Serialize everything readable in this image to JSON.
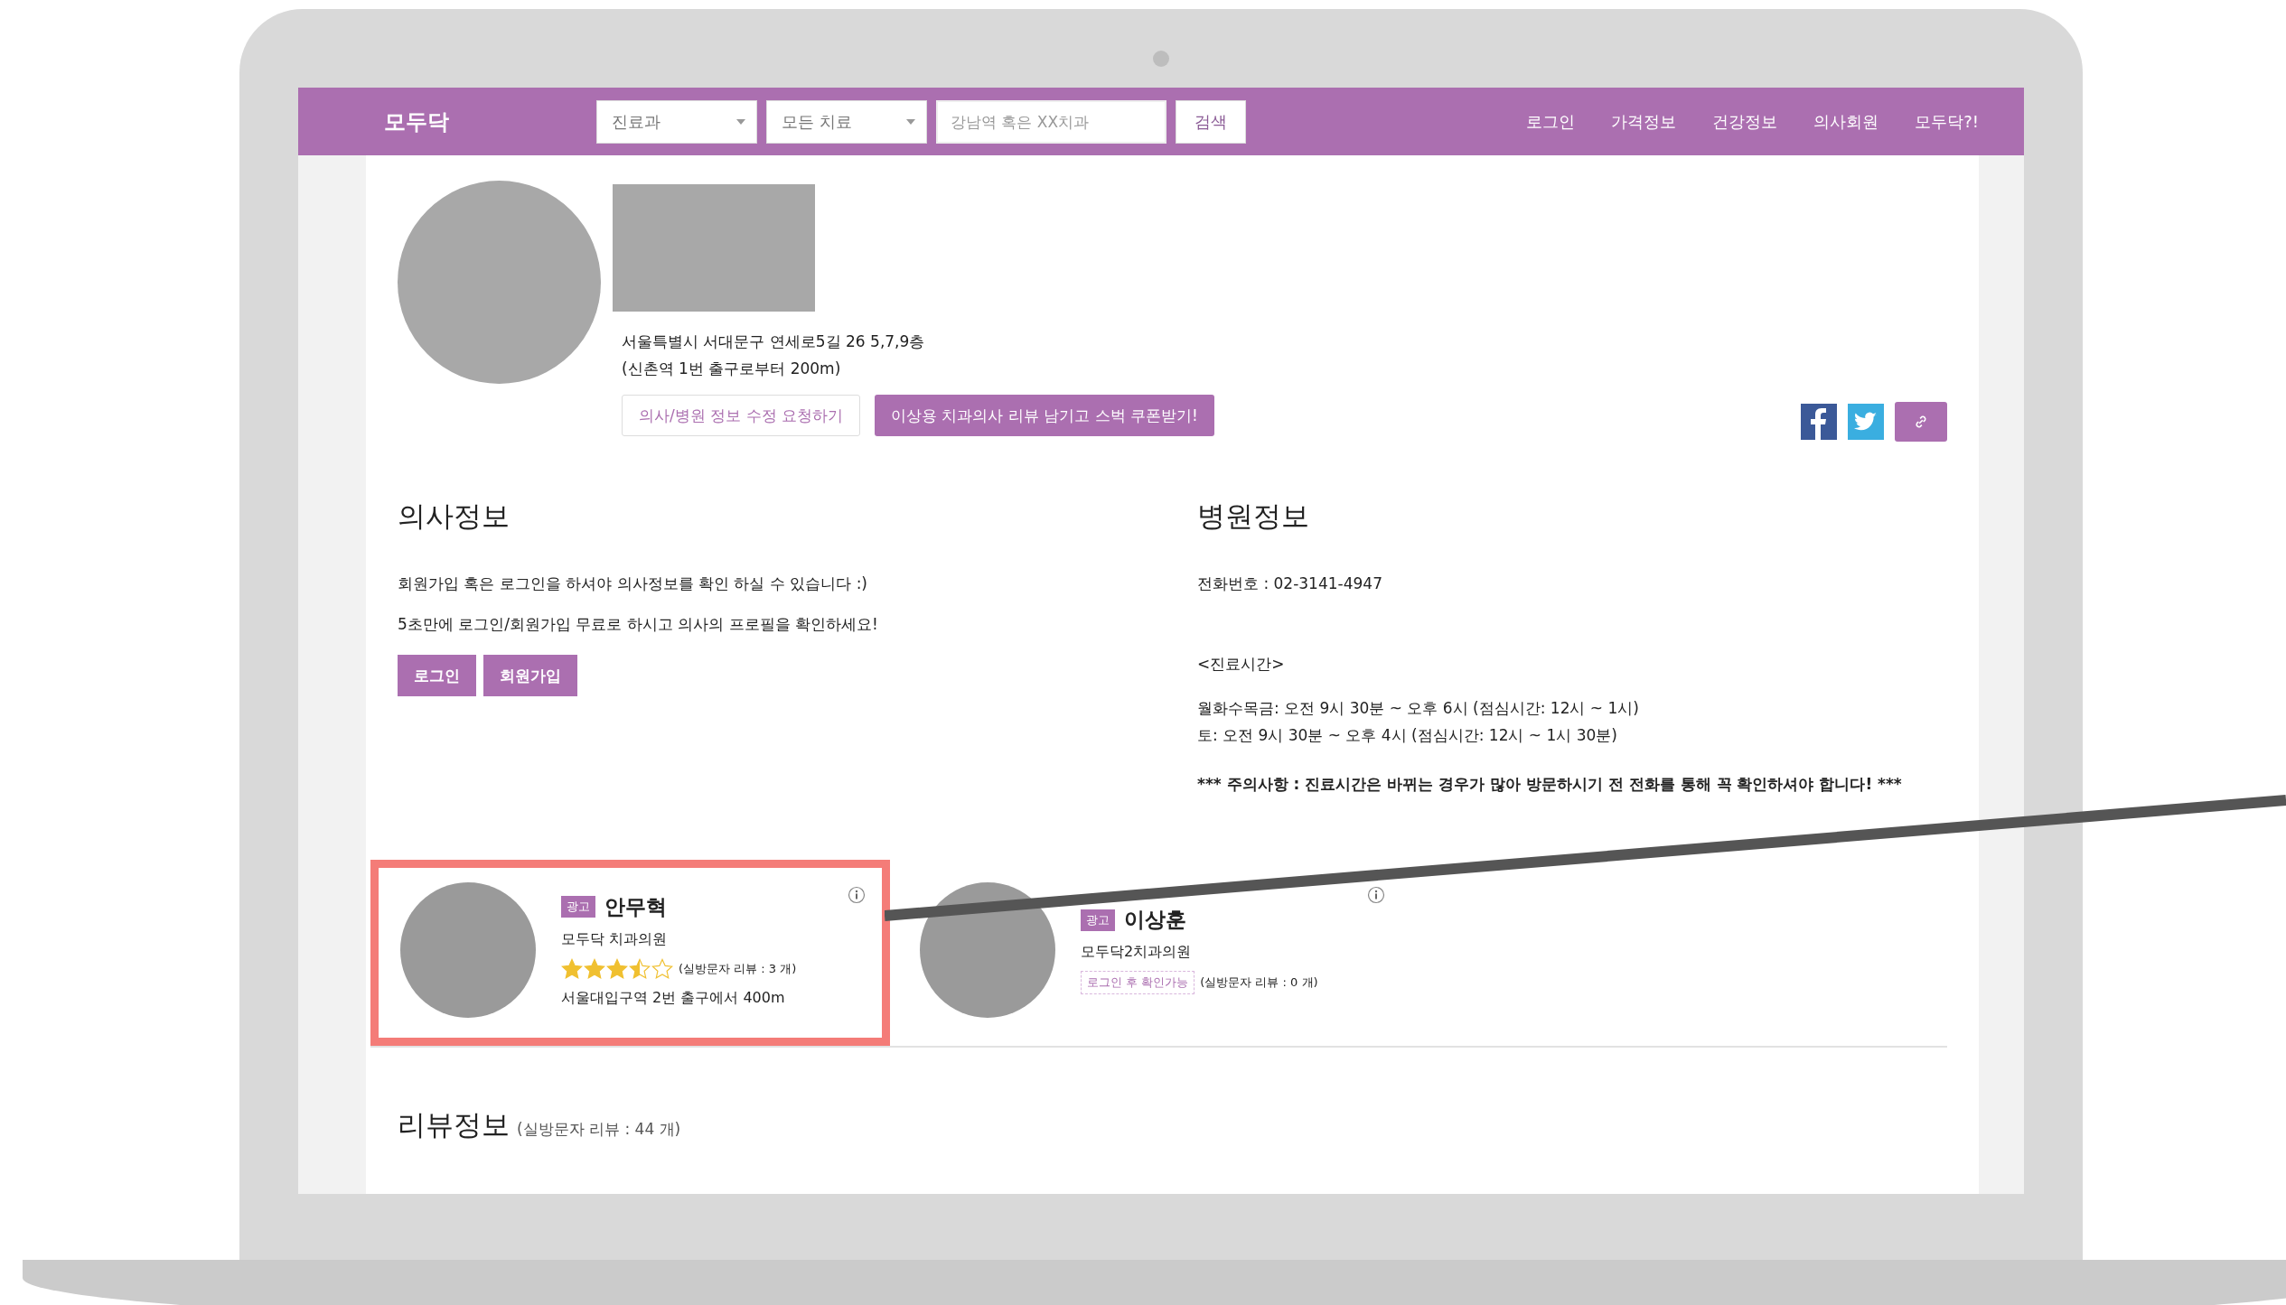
{
  "header": {
    "logo": "모두닥",
    "dropdowns": [
      {
        "label": "진료과"
      },
      {
        "label": "모든 치료"
      }
    ],
    "search": {
      "placeholder": "강남역 혹은 XX치과"
    },
    "search_button": "검색",
    "nav": [
      "로그인",
      "가격정보",
      "건강정보",
      "의사회원",
      "모두닥?!"
    ]
  },
  "profile": {
    "address": [
      "서울특별시 서대문구 연세로5길 26 5,7,9층",
      "(신촌역 1번 출구로부터 200m)"
    ],
    "buttons": [
      {
        "label": "의사/병원 정보 수정 요청하기",
        "kind": "outline"
      },
      {
        "label": "이상용 치과의사 리뷰 남기고 스벅 쿠폰받기!",
        "kind": "filled"
      }
    ]
  },
  "doctor_info": {
    "title": "의사정보",
    "lines": [
      "회원가입 혹은 로그인을 하셔야 의사정보를 확인 하실 수 있습니다 :)",
      "5초만에 로그인/회원가입 무료로 하시고 의사의 프로필을 확인하세요!"
    ],
    "buttons": [
      "로그인",
      "회원가입"
    ]
  },
  "hospital_info": {
    "title": "병원정보",
    "phone": "전화번호 : 02-3141-4947",
    "hours_title": "<진료시간>",
    "hours": [
      "월화수목금: 오전 9시 30분 ~ 오후 6시 (점심시간: 12시 ~ 1시)",
      "토: 오전 9시 30분 ~ 오후 4시 (점심시간: 12시 ~ 1시 30분)"
    ],
    "notice": "*** 주의사항 : 진료시간은 바뀌는 경우가 많아 방문하시기 전 전화를 통해 꼭 확인하셔야 합니다! ***"
  },
  "ads": [
    {
      "badge": "광고",
      "name": "안무혁",
      "clinic": "모두닥 치과의원",
      "kind": "stars",
      "stars": 3.5,
      "reviews": "(실방문자 리뷰 : 3 개)",
      "distance": "서울대입구역 2번 출구에서 400m",
      "highlighted": true
    },
    {
      "badge": "광고",
      "name": "이상훈",
      "clinic": "모두닥2치과의원",
      "kind": "locked",
      "locked_label": "로그인 후 확인가능",
      "reviews": "(실방문자 리뷰 : 0 개)",
      "highlighted": false
    }
  ],
  "reviews": {
    "title": "리뷰정보",
    "count": "(실방문자 리뷰 : 44 개)"
  }
}
